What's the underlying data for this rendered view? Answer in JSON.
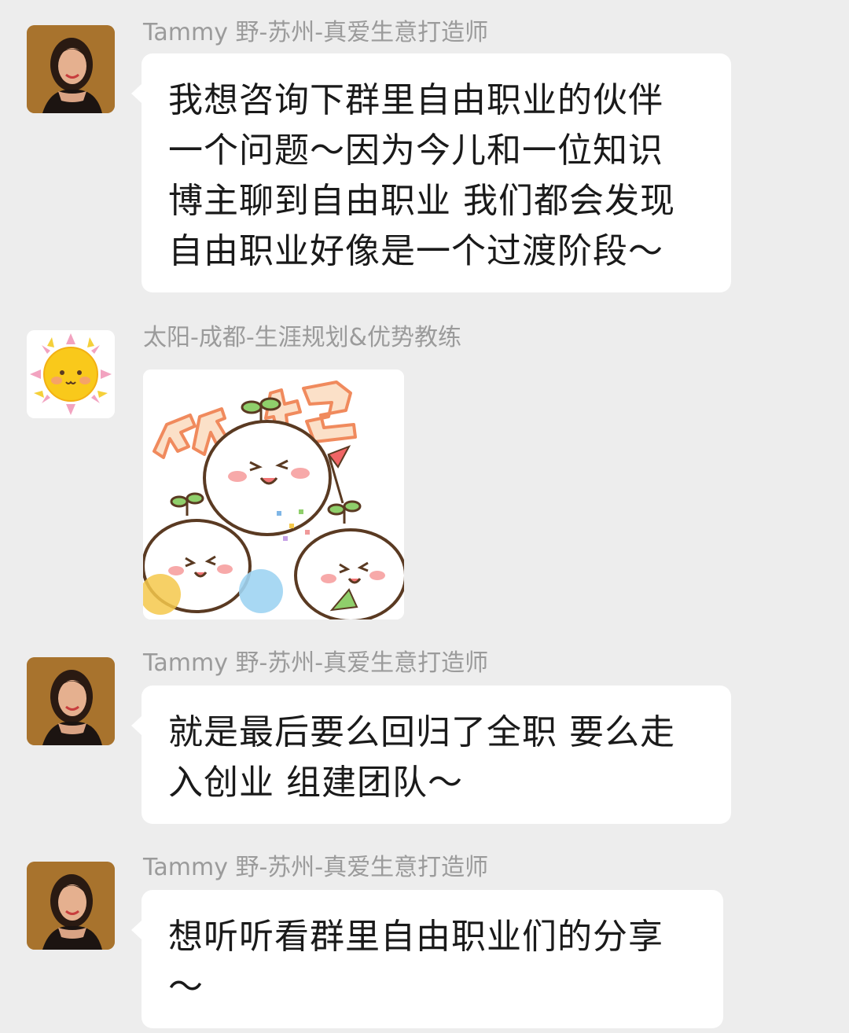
{
  "messages": [
    {
      "sender": "Tammy 野-苏州-真爱生意打造师",
      "lines": [
        "我想咨询下群里自由职业的伙伴",
        "一个问题～因为今儿和一位知识",
        "博主聊到自由职业 我们都会发现",
        " 自由职业好像是一个过渡阶段～"
      ]
    },
    {
      "sender": "太阳-成都-生涯规划&优势教练",
      "sticker_text": "欢迎"
    },
    {
      "sender": "Tammy 野-苏州-真爱生意打造师",
      "lines": [
        "就是最后要么回归了全职 要么走",
        "入创业 组建团队～"
      ]
    },
    {
      "sender": "Tammy 野-苏州-真爱生意打造师",
      "lines": [
        "想听听看群里自由职业们的分享",
        "～"
      ]
    }
  ],
  "colors": {
    "background": "#ededed",
    "bubble": "#ffffff",
    "sender_text": "#9b9b9b",
    "message_text": "#1a1a1a"
  },
  "icons": {
    "avatar_1": "woman-portrait-avatar",
    "avatar_2": "sun-avatar",
    "sticker": "welcome-sticker"
  }
}
